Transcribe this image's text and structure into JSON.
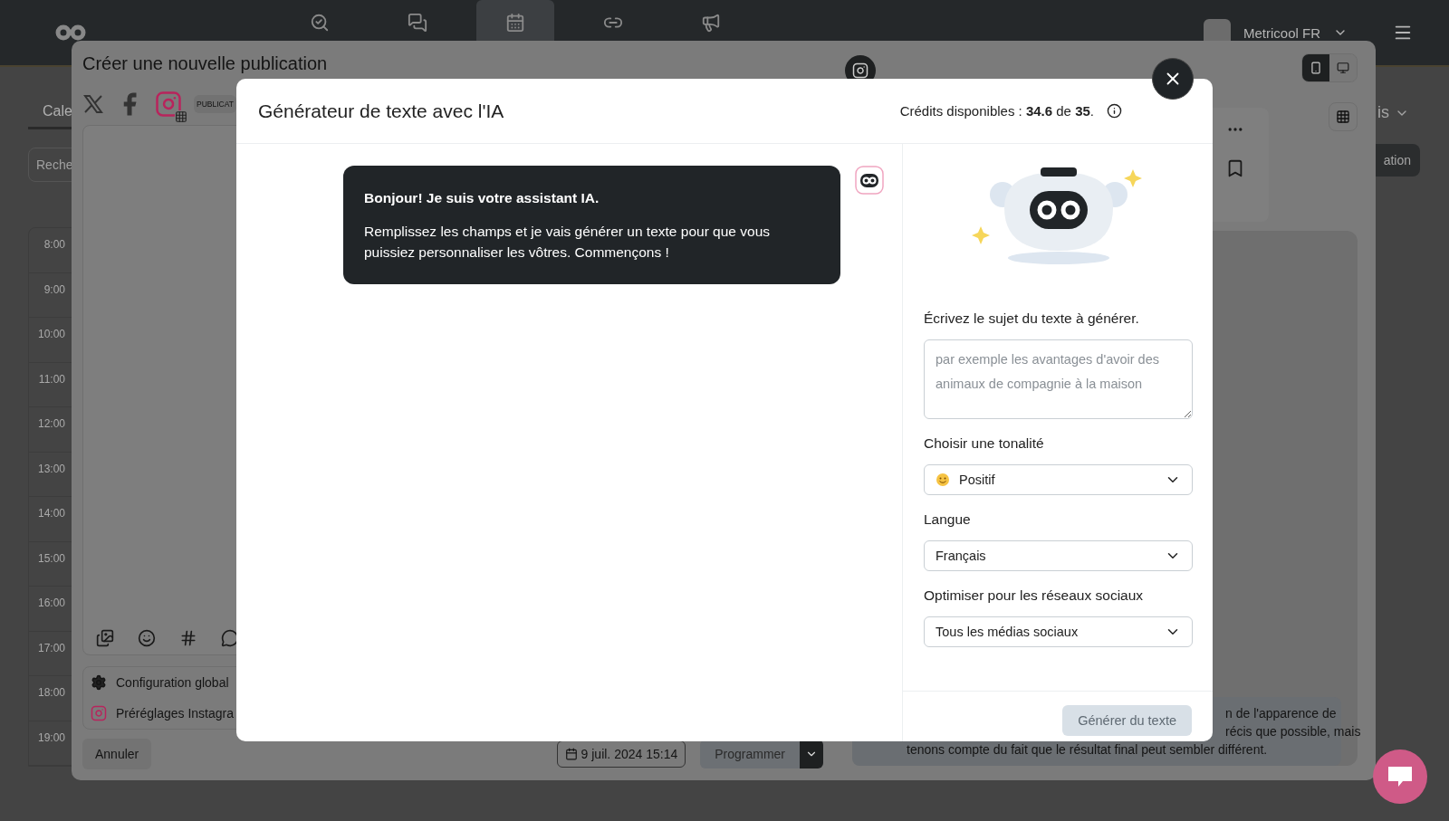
{
  "app": {
    "nav": [
      {
        "kind": "analytics",
        "selected": false
      },
      {
        "kind": "inbox",
        "selected": false
      },
      {
        "kind": "planner",
        "selected": true
      },
      {
        "kind": "links",
        "selected": false
      },
      {
        "kind": "ads",
        "selected": false
      }
    ],
    "account": "Metricool FR",
    "calendar": {
      "tab": "Cale",
      "search_placeholder": "Reche",
      "times": [
        "8:00",
        "9:00",
        "10:00",
        "11:00",
        "12:00",
        "13:00",
        "14:00",
        "15:00",
        "16:00",
        "17:00",
        "18:00",
        "19:00"
      ]
    },
    "right": {
      "dropdown": "is",
      "button": "ation"
    }
  },
  "publication_modal": {
    "title": "Créer une nouvelle publication",
    "networks": [
      {
        "kind": "x",
        "selected": false
      },
      {
        "kind": "facebook",
        "selected": false
      },
      {
        "kind": "instagram",
        "selected": true
      }
    ],
    "chip": "PUBLICAT",
    "toolbar": [
      {
        "kind": "media"
      },
      {
        "kind": "emoji"
      },
      {
        "kind": "hashtag"
      },
      {
        "kind": "comment"
      }
    ],
    "settings": [
      {
        "kind": "gear",
        "label": "Configuration global"
      },
      {
        "kind": "instagram",
        "label": "Préréglages Instagra"
      }
    ],
    "cancel": "Annuler",
    "date": "9 juil. 2024 15:14",
    "schedule": "Programmer",
    "preview": {
      "devices": [
        {
          "kind": "mobile",
          "selected": true
        },
        {
          "kind": "desktop",
          "selected": false
        }
      ],
      "note_lines": [
        "n de l'apparence de",
        "récis que possible, mais",
        "tenons compte du fait que le résultat final peut sembler différent."
      ]
    }
  },
  "ai_modal": {
    "title": "Générateur de texte avec l'IA",
    "credits": "Crédits disponibles : **34.6** de **35**.",
    "message": {
      "title": "Bonjour! Je suis votre assistant IA.",
      "text": "Remplissez les champs et je vais générer un texte pour que vous puissiez personnaliser les vôtres. Commençons !"
    },
    "fields": [
      {
        "kind": "textarea",
        "label": "Écrivez le sujet du texte à générer.",
        "placeholder": "par exemple les avantages d'avoir des animaux de compagnie à la maison"
      },
      {
        "kind": "emoji_select",
        "label": "Choisir une tonalité",
        "value": "Positif"
      },
      {
        "kind": "select",
        "label": "Langue",
        "value": "Français"
      },
      {
        "kind": "select",
        "label": "Optimiser pour les réseaux sociaux",
        "value": "Tous les médias sociaux"
      }
    ],
    "submit": {
      "label": "Générer du texte",
      "disabled": true
    }
  }
}
